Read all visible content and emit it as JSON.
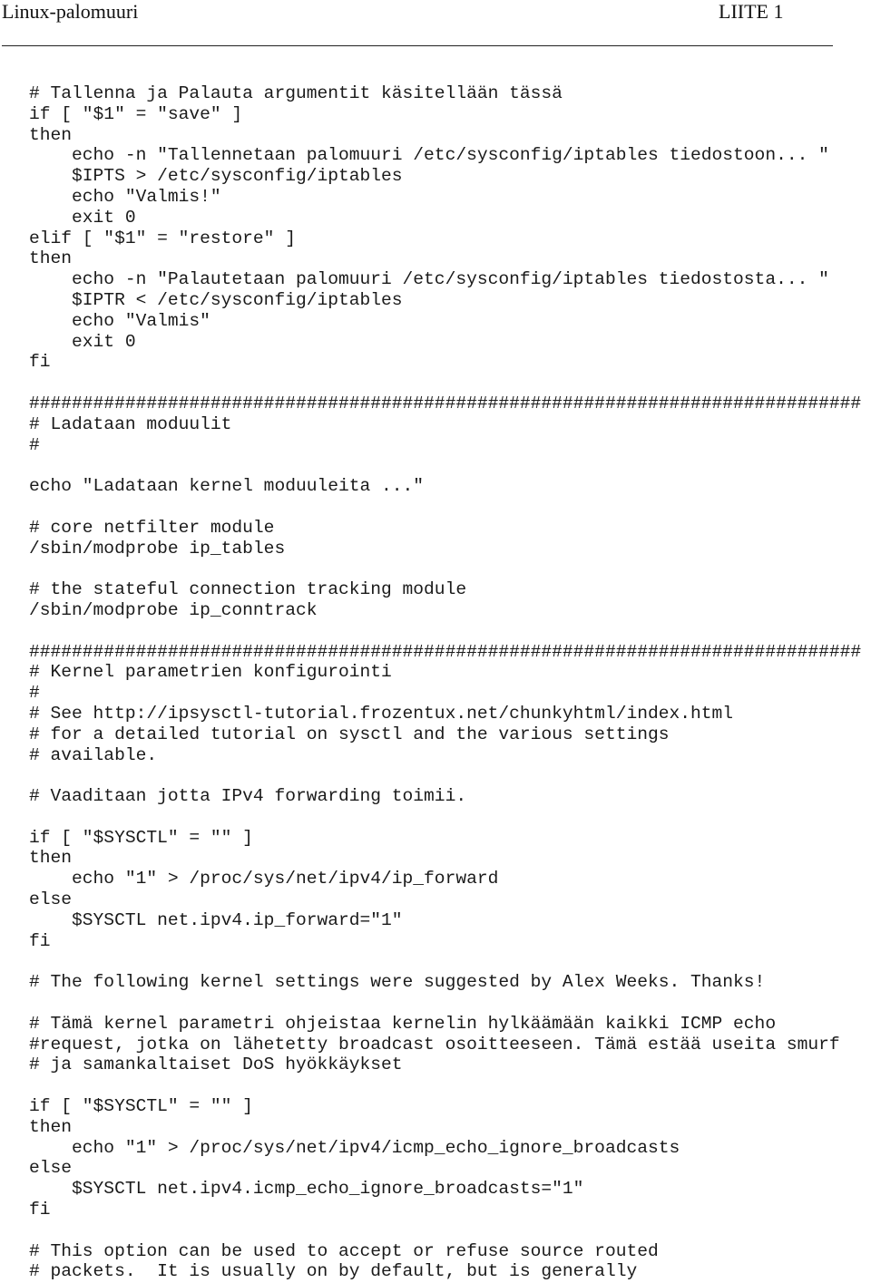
{
  "header": {
    "title": "Linux-palomuuri",
    "appendix": "LIITE 1"
  },
  "code_lines": [
    "# Tallenna ja Palauta argumentit käsitellään tässä",
    "if [ \"$1\" = \"save\" ]",
    "then",
    "    echo -n \"Tallennetaan palomuuri /etc/sysconfig/iptables tiedostoon... \"",
    "    $IPTS > /etc/sysconfig/iptables",
    "    echo \"Valmis!\"",
    "    exit 0",
    "elif [ \"$1\" = \"restore\" ]",
    "then",
    "    echo -n \"Palautetaan palomuuri /etc/sysconfig/iptables tiedostosta... \"",
    "    $IPTR < /etc/sysconfig/iptables",
    "    echo \"Valmis\"",
    "    exit 0",
    "fi",
    "",
    "##############################################################################",
    "# Ladataan moduulit",
    "#",
    "",
    "echo \"Ladataan kernel moduuleita ...\"",
    "",
    "# core netfilter module",
    "/sbin/modprobe ip_tables",
    "",
    "# the stateful connection tracking module",
    "/sbin/modprobe ip_conntrack",
    "",
    "##############################################################################",
    "# Kernel parametrien konfigurointi",
    "#",
    "# See http://ipsysctl-tutorial.frozentux.net/chunkyhtml/index.html",
    "# for a detailed tutorial on sysctl and the various settings",
    "# available.",
    "",
    "# Vaaditaan jotta IPv4 forwarding toimii.",
    "",
    "if [ \"$SYSCTL\" = \"\" ]",
    "then",
    "    echo \"1\" > /proc/sys/net/ipv4/ip_forward",
    "else",
    "    $SYSCTL net.ipv4.ip_forward=\"1\"",
    "fi",
    "",
    "# The following kernel settings were suggested by Alex Weeks. Thanks!",
    "",
    "# Tämä kernel parametri ohjeistaa kernelin hylkäämään kaikki ICMP echo",
    "#request, jotka on lähetetty broadcast osoitteeseen. Tämä estää useita smurf",
    "# ja samankaltaiset DoS hyökkäykset",
    "",
    "if [ \"$SYSCTL\" = \"\" ]",
    "then",
    "    echo \"1\" > /proc/sys/net/ipv4/icmp_echo_ignore_broadcasts",
    "else",
    "    $SYSCTL net.ipv4.icmp_echo_ignore_broadcasts=\"1\"",
    "fi",
    "",
    "# This option can be used to accept or refuse source routed",
    "# packets.  It is usually on by default, but is generally"
  ]
}
